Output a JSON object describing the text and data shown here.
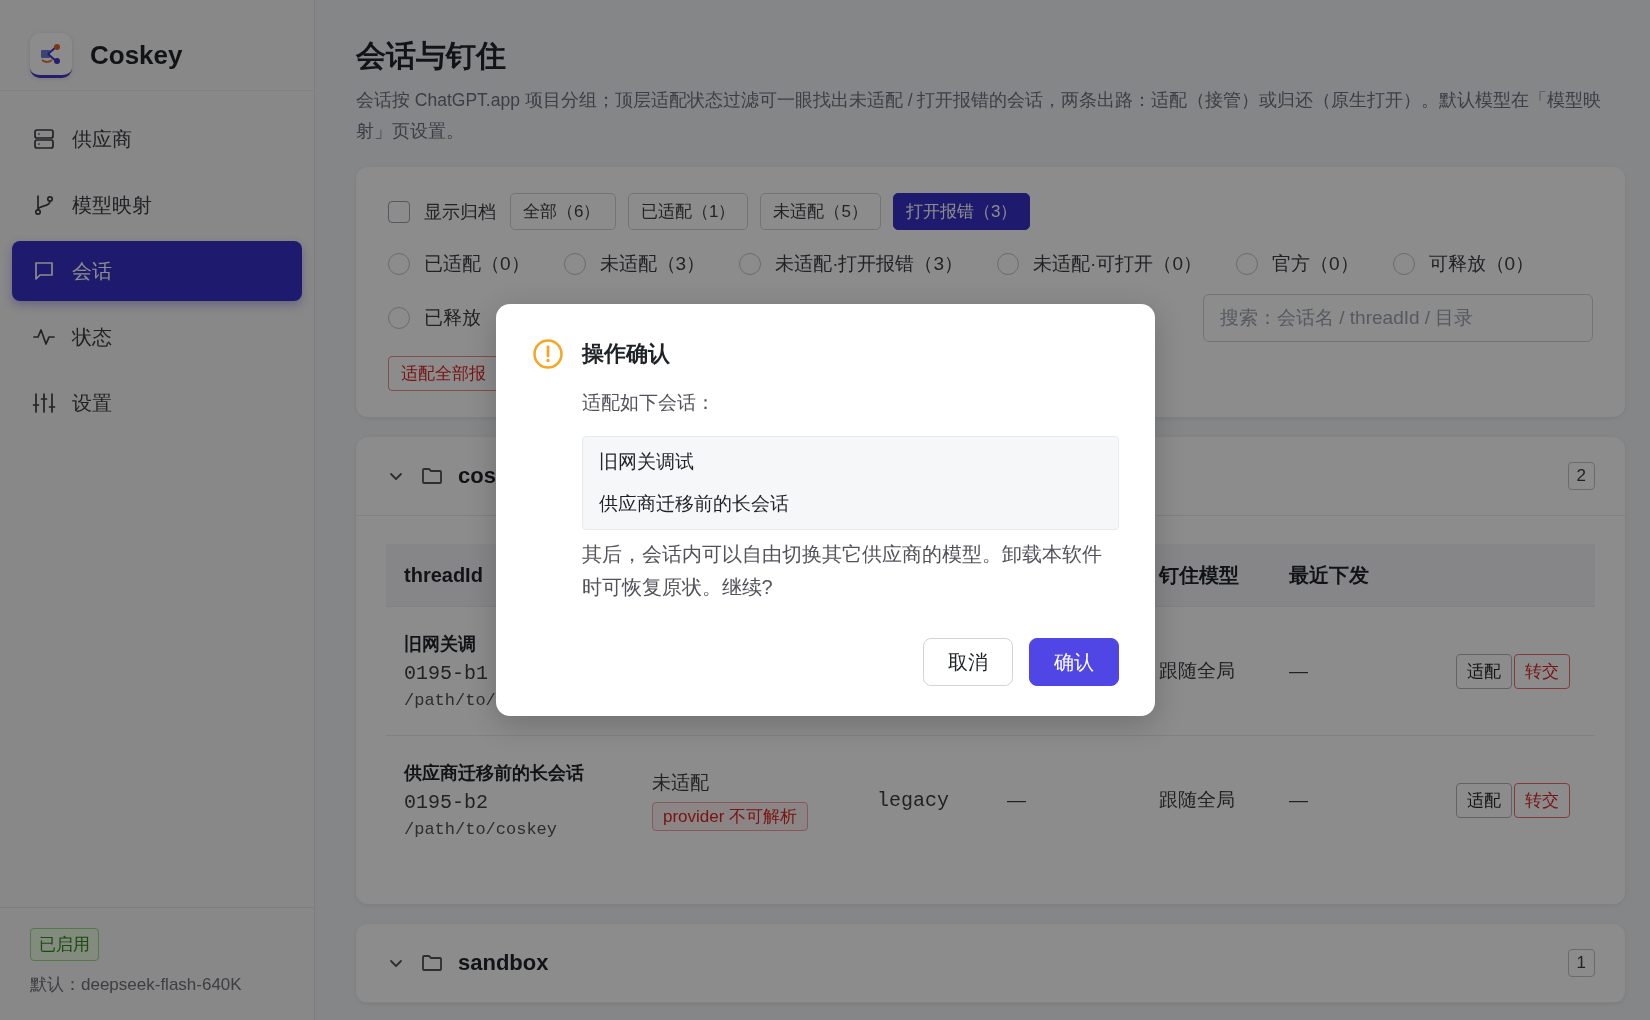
{
  "app": {
    "name": "Coskey"
  },
  "sidebar": {
    "items": [
      {
        "label": "供应商",
        "selected": false
      },
      {
        "label": "模型映射",
        "selected": false
      },
      {
        "label": "会话",
        "selected": true
      },
      {
        "label": "状态",
        "selected": false
      },
      {
        "label": "设置",
        "selected": false
      }
    ],
    "status_badge": "已启用",
    "default_model": "默认：deepseek-flash-640K"
  },
  "page": {
    "title": "会话与钉住",
    "description": "会话按 ChatGPT.app 项目分组；顶层适配状态过滤可一眼找出未适配 / 打开报错的会话，两条出路：适配（接管）或归还（原生打开）。默认模型在「模型映射」页设置。"
  },
  "filters": {
    "show_archived": {
      "label": "显示归档",
      "checked": false
    },
    "tabs": [
      {
        "label": "全部（6）",
        "selected": false
      },
      {
        "label": "已适配（1）",
        "selected": false
      },
      {
        "label": "未适配（5）",
        "selected": false
      },
      {
        "label": "打开报错（3）",
        "selected": true
      }
    ],
    "radios": [
      {
        "label": "已适配（0）",
        "selected": false
      },
      {
        "label": "未适配（3）",
        "selected": false
      },
      {
        "label": "未适配·打开报错（3）",
        "selected": false
      },
      {
        "label": "未适配·可打开（0）",
        "selected": false
      },
      {
        "label": "官方（0）",
        "selected": false
      },
      {
        "label": "可释放（0）",
        "selected": false
      },
      {
        "label": "已释放",
        "selected": false
      }
    ],
    "search": {
      "placeholder": "搜索：会话名 / threadId / 目录"
    },
    "bulk_button": "适配全部报"
  },
  "groups": [
    {
      "name": "cos",
      "count": "2",
      "expanded": true,
      "columns": [
        "threadId",
        "钉住模型",
        "最近下发"
      ],
      "rows": [
        {
          "name": "旧网关调",
          "id": "0195-b1",
          "path": "/path/to/",
          "pinned": "跟随全局",
          "recent": "—",
          "actions": [
            "适配",
            "转交"
          ]
        },
        {
          "name": "供应商迁移前的长会话",
          "id": "0195-b2",
          "path": "/path/to/coskey",
          "status": "未适配",
          "badge": "provider 不可解析",
          "column_3": "legacy",
          "column_4": "—",
          "pinned": "跟随全局",
          "recent": "—",
          "actions": [
            "适配",
            "转交"
          ]
        }
      ]
    },
    {
      "name": "sandbox",
      "count": "1",
      "expanded": true
    }
  ],
  "dialog": {
    "title": "操作确认",
    "intro": "适配如下会话：",
    "items": [
      "旧网关调试",
      "供应商迁移前的长会话"
    ],
    "message": "其后，会话内可以自由切换其它供应商的模型。卸载本软件时可恢复原状。继续?",
    "buttons": [
      {
        "label": "取消",
        "primary": false
      },
      {
        "label": "确认",
        "primary": true
      }
    ]
  }
}
